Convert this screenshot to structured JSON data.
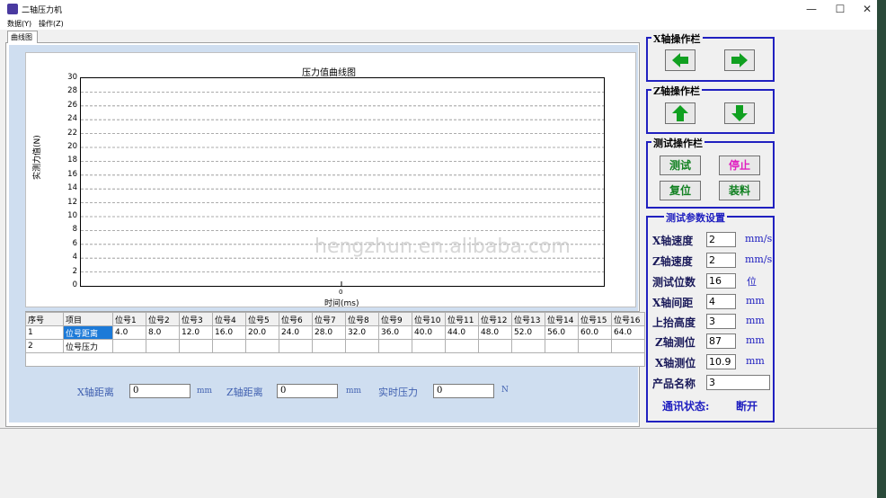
{
  "window": {
    "title": "二轴压力机",
    "min": "—",
    "max": "☐",
    "close": "✕"
  },
  "menu": {
    "data": "数据(Y)",
    "operate": "操作(Z)"
  },
  "tab": {
    "label": "曲线图"
  },
  "chart_data": {
    "type": "line",
    "title": "压力值曲线图",
    "xlabel": "时间(ms)",
    "ylabel": "实测力值(N)",
    "ylim": [
      0,
      30
    ],
    "yticks": [
      "30",
      "28",
      "26",
      "24",
      "22",
      "20",
      "18",
      "16",
      "14",
      "12",
      "10",
      "8",
      "6",
      "4",
      "2",
      "0"
    ],
    "xticks": [
      "0"
    ],
    "grid": true,
    "series": []
  },
  "watermark": "hengzhun.en.alibaba.com",
  "table": {
    "headers": [
      "序号",
      "项目",
      "位号1",
      "位号2",
      "位号3",
      "位号4",
      "位号5",
      "位号6",
      "位号7",
      "位号8",
      "位号9",
      "位号10",
      "位号11",
      "位号12",
      "位号13",
      "位号14",
      "位号15",
      "位号16"
    ],
    "rows": [
      [
        "1",
        "位号距离",
        "4.0",
        "8.0",
        "12.0",
        "16.0",
        "20.0",
        "24.0",
        "28.0",
        "32.0",
        "36.0",
        "40.0",
        "44.0",
        "48.0",
        "52.0",
        "56.0",
        "60.0",
        "64.0"
      ],
      [
        "2",
        "位号压力",
        "",
        "",
        "",
        "",
        "",
        "",
        "",
        "",
        "",
        "",
        "",
        "",
        "",
        "",
        "",
        ""
      ]
    ]
  },
  "bottom": {
    "x_label": "X轴距离",
    "x_value": "0",
    "x_unit": "mm",
    "z_label": "Z轴距离",
    "z_value": "0",
    "z_unit": "mm",
    "p_label": "实时压力",
    "p_value": "0",
    "p_unit": "N"
  },
  "x_panel": {
    "title": "X轴操作栏",
    "left_icon": "arrow-left-icon",
    "right_icon": "arrow-right-icon"
  },
  "z_panel": {
    "title": "Z轴操作栏",
    "up_icon": "arrow-up-icon",
    "down_icon": "arrow-down-icon"
  },
  "test_panel": {
    "title": "测试操作栏",
    "test": "测试",
    "stop": "停止",
    "reset": "复位",
    "load": "装料"
  },
  "params": {
    "title": "测试参数设置",
    "x_speed_label": "X轴速度",
    "x_speed": "2",
    "x_speed_unit": "mm/s",
    "z_speed_label": "Z轴速度",
    "z_speed": "2",
    "z_speed_unit": "mm/s",
    "count_label": "测试位数",
    "count": "16",
    "count_unit": "位",
    "x_gap_label": "X轴间距",
    "x_gap": "4",
    "x_gap_unit": "mm",
    "lift_label": "上抬高度",
    "lift": "3",
    "lift_unit": "mm",
    "z_pos_label": "Z轴测位",
    "z_pos": "87",
    "z_pos_unit": "mm",
    "x_pos_label": "X轴测位",
    "x_pos": "10.9",
    "x_pos_unit": "mm",
    "product_label": "产品名称",
    "product": "3",
    "comm_label": "通讯状态:",
    "comm_status": "断开"
  },
  "colors": {
    "accent": "#2020c0",
    "arrow_green": "#10a020",
    "stop_pink": "#e020c0"
  }
}
